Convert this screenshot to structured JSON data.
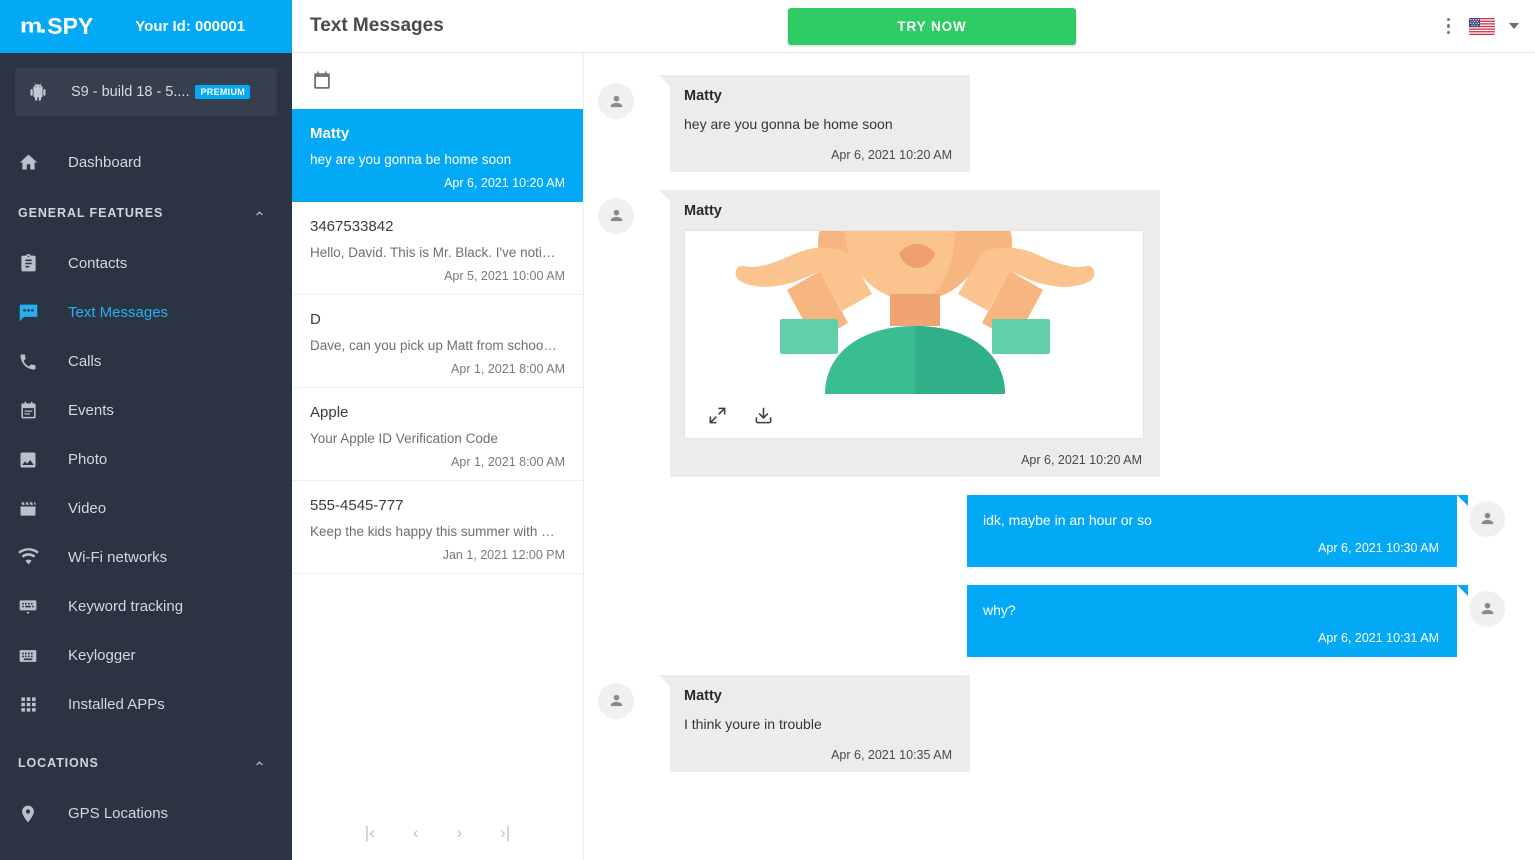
{
  "brand": {
    "logo_m": "m",
    "logo_spy": "SPY",
    "your_id": "Your Id: 000001",
    "accent_blue": "#03a9f4",
    "sidebar_dark": "#2b3442",
    "cta_green": "#2ecc62"
  },
  "device": {
    "name": "S9 - build 18 - 5....",
    "badge": "PREMIUM",
    "icon": "android-icon"
  },
  "sidebar": {
    "dashboard": {
      "label": "Dashboard",
      "icon": "home-icon"
    },
    "general_header": {
      "label": "GENERAL FEATURES",
      "icon": "chevron-up-icon"
    },
    "general_items": [
      {
        "label": "Contacts",
        "icon": "contacts-icon",
        "active": false
      },
      {
        "label": "Text Messages",
        "icon": "message-icon",
        "active": true
      },
      {
        "label": "Calls",
        "icon": "phone-icon",
        "active": false
      },
      {
        "label": "Events",
        "icon": "calendar-icon",
        "active": false
      },
      {
        "label": "Photo",
        "icon": "photo-icon",
        "active": false
      },
      {
        "label": "Video",
        "icon": "video-icon",
        "active": false
      },
      {
        "label": "Wi-Fi networks",
        "icon": "wifi-icon",
        "active": false
      },
      {
        "label": "Keyword tracking",
        "icon": "keyword-icon",
        "active": false
      },
      {
        "label": "Keylogger",
        "icon": "keyboard-icon",
        "active": false
      },
      {
        "label": "Installed APPs",
        "icon": "grid-icon",
        "active": false
      }
    ],
    "locations_header": {
      "label": "LOCATIONS",
      "icon": "chevron-up-icon"
    },
    "locations_items": [
      {
        "label": "GPS Locations",
        "icon": "pin-icon",
        "active": false
      }
    ]
  },
  "topbar": {
    "title": "Text Messages",
    "try_now": "TRY NOW",
    "kebab_icon": "more-vertical-icon",
    "flag_icon": "us-flag-icon",
    "caret_icon": "chevron-down-icon"
  },
  "conversations": {
    "calendar_icon": "calendar-icon",
    "items": [
      {
        "name": "Matty",
        "preview": "hey are you gonna be home soon",
        "date": "Apr 6, 2021 10:20 AM",
        "selected": true
      },
      {
        "name": "3467533842",
        "preview": "Hello, David. This is Mr. Black. I've noti…",
        "date": "Apr 5, 2021 10:00 AM",
        "selected": false
      },
      {
        "name": "D",
        "preview": "Dave, can you pick up Matt from schoo…",
        "date": "Apr 1, 2021 8:00 AM",
        "selected": false
      },
      {
        "name": "Apple",
        "preview": "Your Apple ID Verification Code",
        "date": "Apr 1, 2021 8:00 AM",
        "selected": false
      },
      {
        "name": "555-4545-777",
        "preview": "Keep the kids happy this summer with …",
        "date": "Jan 1, 2021 12:00 PM",
        "selected": false
      }
    ],
    "pager": {
      "first": "|‹",
      "prev": "‹",
      "next": "›",
      "last": "›|"
    }
  },
  "thread": {
    "messages": [
      {
        "direction": "in",
        "sender": "Matty",
        "body": "hey are you gonna be home soon",
        "time": "Apr 6, 2021 10:20 AM",
        "attachment": null
      },
      {
        "direction": "in",
        "sender": "Matty",
        "body": "",
        "time": "Apr 6, 2021 10:20 AM",
        "attachment": {
          "kind": "image",
          "alt": "shrugging-person-illustration",
          "expand_icon": "expand-icon",
          "download_icon": "download-icon"
        }
      },
      {
        "direction": "out",
        "sender": "",
        "body": "idk, maybe in an hour or so",
        "time": "Apr 6, 2021 10:30 AM",
        "attachment": null
      },
      {
        "direction": "out",
        "sender": "",
        "body": "why?",
        "time": "Apr 6, 2021 10:31 AM",
        "attachment": null
      },
      {
        "direction": "in",
        "sender": "Matty",
        "body": "I think youre in trouble",
        "time": "Apr 6, 2021 10:35 AM",
        "attachment": null
      }
    ]
  }
}
